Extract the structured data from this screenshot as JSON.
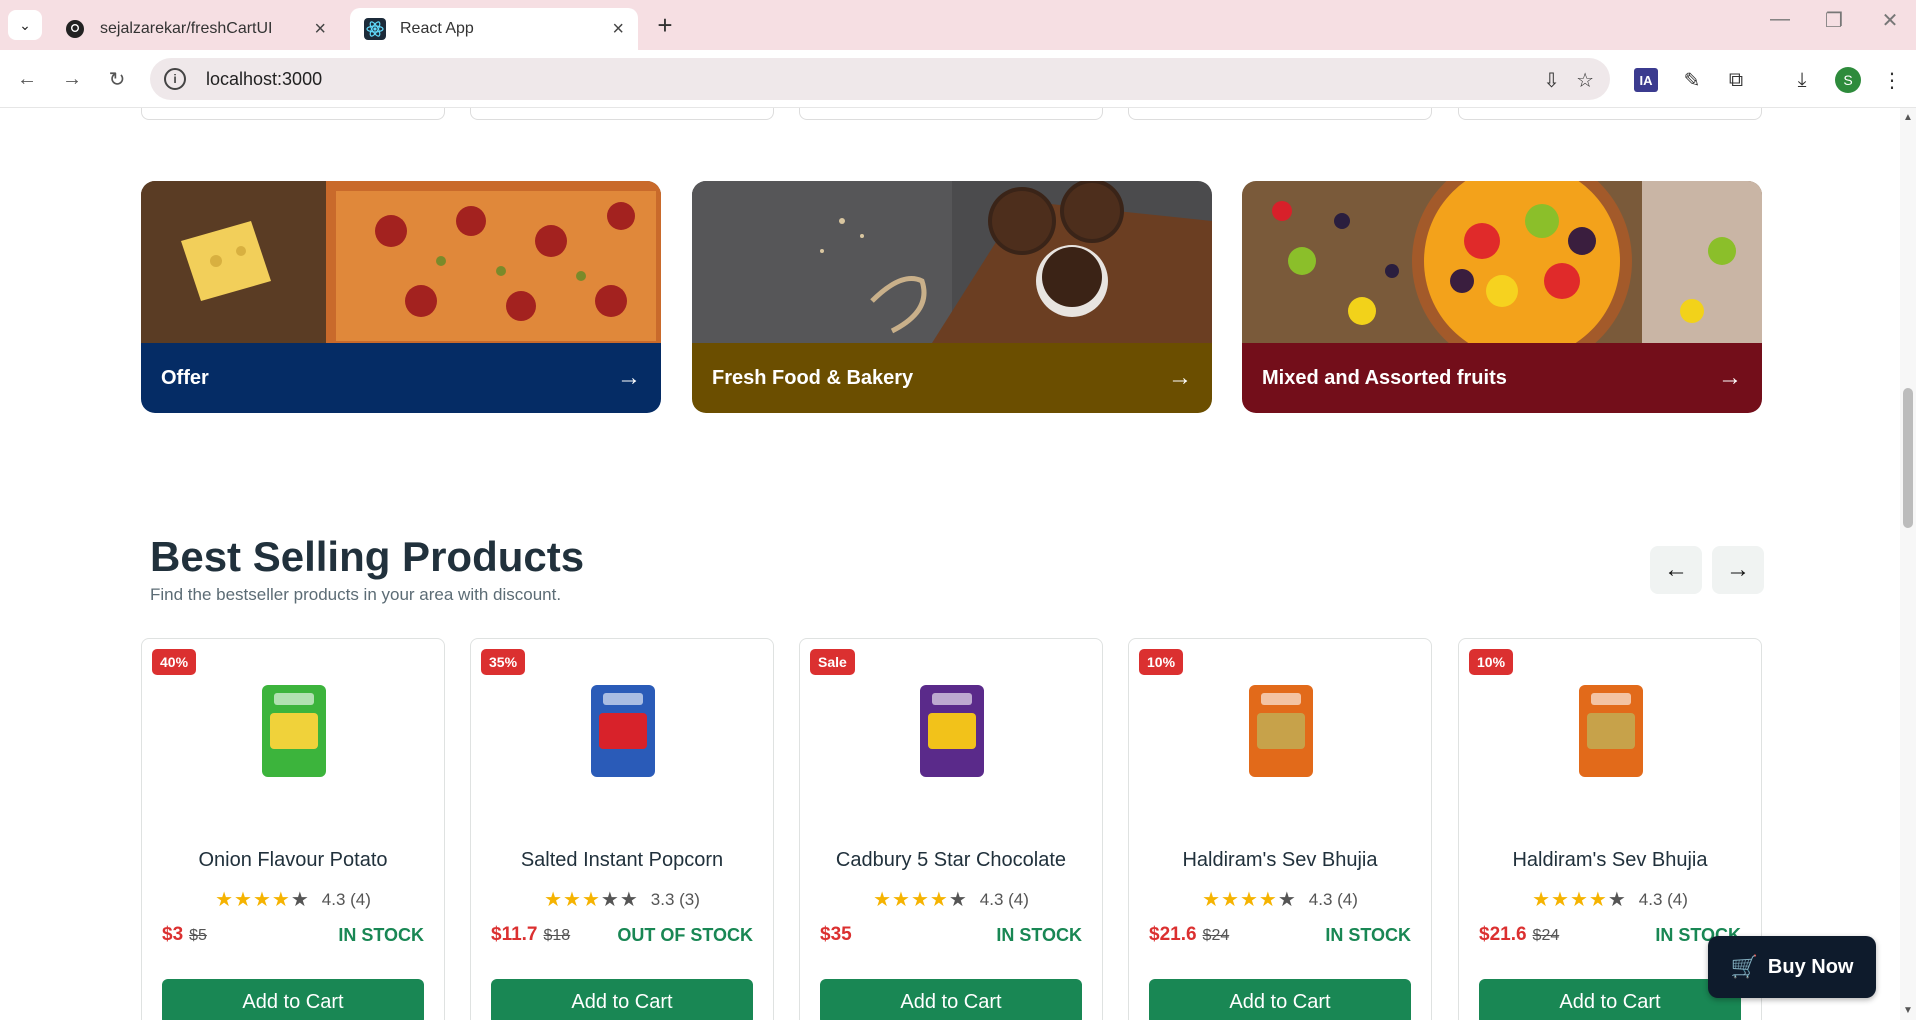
{
  "browser": {
    "tabs": [
      {
        "title": "sejalzarekar/freshCartUI",
        "icon": "github-icon"
      },
      {
        "title": "React App",
        "icon": "react-icon"
      }
    ],
    "url": "localhost:3000",
    "profile_initial": "S",
    "ext_badge": "IA"
  },
  "banners": [
    {
      "label": "Offer",
      "color": "#052c65"
    },
    {
      "label": "Fresh Food & Bakery",
      "color": "#6b4e00"
    },
    {
      "label": "Mixed and Assorted fruits",
      "color": "#730e1a"
    }
  ],
  "section": {
    "title": "Best Selling Products",
    "subtitle": "Find the bestseller products in your area with discount."
  },
  "products": [
    {
      "badge": "40%",
      "name": "Onion Flavour Potato",
      "rating": "4.3 (4)",
      "stars": 4,
      "price": "$3",
      "old_price": "$5",
      "stock": "IN STOCK",
      "stock_color": "#198754",
      "cta": "Add to Cart"
    },
    {
      "badge": "35%",
      "name": "Salted Instant Popcorn",
      "rating": "3.3 (3)",
      "stars": 3,
      "price": "$11.7",
      "old_price": "$18",
      "stock": "OUT OF STOCK",
      "stock_color": "#198754",
      "cta": "Add to Cart"
    },
    {
      "badge": "Sale",
      "name": "Cadbury 5 Star Chocolate",
      "rating": "4.3 (4)",
      "stars": 4,
      "price": "$35",
      "old_price": "",
      "stock": "IN STOCK",
      "stock_color": "#198754",
      "cta": "Add to Cart"
    },
    {
      "badge": "10%",
      "name": "Haldiram's Sev Bhujia",
      "rating": "4.3 (4)",
      "stars": 4,
      "price": "$21.6",
      "old_price": "$24",
      "stock": "IN STOCK",
      "stock_color": "#198754",
      "cta": "Add to Cart"
    },
    {
      "badge": "10%",
      "name": "Haldiram's Sev Bhujia",
      "rating": "4.3 (4)",
      "stars": 4,
      "price": "$21.6",
      "old_price": "$24",
      "stock": "IN STOCK",
      "stock_color": "#198754",
      "cta": "Add to Cart"
    }
  ],
  "buy_now": {
    "label": "Buy Now"
  }
}
